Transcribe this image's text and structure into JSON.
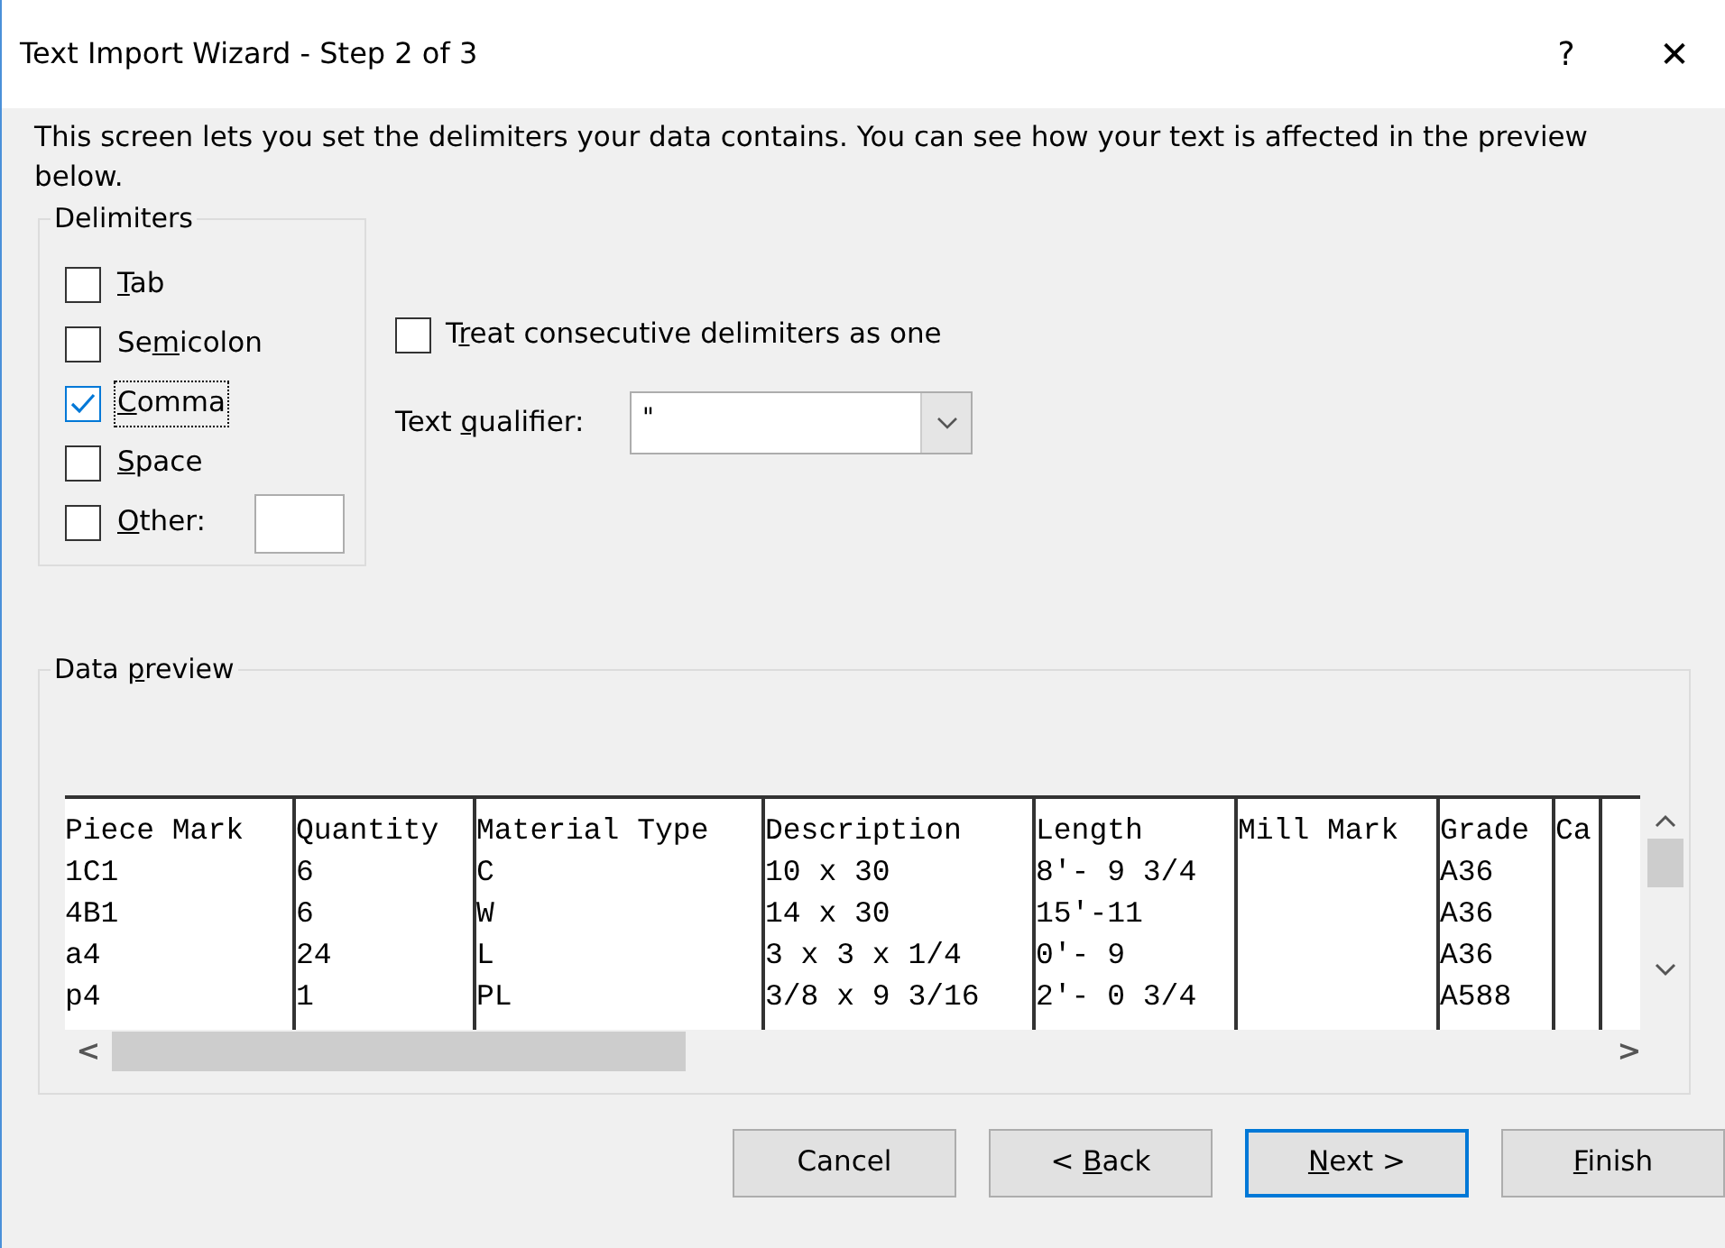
{
  "window": {
    "title": "Text Import Wizard - Step 2 of 3",
    "help": "?",
    "close": "✕"
  },
  "description": "This screen lets you set the delimiters your data contains.  You can see how your text is affected in the preview below.",
  "delimiters": {
    "title": "Delimiters",
    "items": [
      {
        "key": "T",
        "post": "ab",
        "checked": false,
        "focused": false,
        "kind": "plain"
      },
      {
        "pre": "Se",
        "key": "m",
        "post": "icolon",
        "checked": false,
        "focused": false,
        "kind": "plain"
      },
      {
        "key": "C",
        "post": "omma",
        "checked": true,
        "focused": true,
        "kind": "plain"
      },
      {
        "key": "S",
        "post": "pace",
        "checked": false,
        "focused": false,
        "kind": "plain"
      },
      {
        "key": "O",
        "post": "ther:",
        "checked": false,
        "focused": false,
        "kind": "other"
      }
    ]
  },
  "treat_consecutive": {
    "pre": "T",
    "key": "r",
    "post": "eat consecutive delimiters as one",
    "checked": false
  },
  "text_qualifier": {
    "pre": "Text ",
    "key": "q",
    "post": "ualifier:",
    "value": "\""
  },
  "data_preview": {
    "pre": "Data ",
    "key": "p",
    "post": "review",
    "columns": [
      "Piece Mark",
      "Quantity",
      "Material Type",
      "Description",
      "Length",
      "Mill Mark",
      "Grade",
      "Ca"
    ],
    "rows": [
      [
        "1C1",
        "6",
        "C",
        "10 x 30",
        "8'- 9 3/4",
        null,
        "A36",
        null
      ],
      [
        "4B1",
        "6",
        "W",
        "14 x 30",
        "15'-11",
        null,
        "A36",
        null
      ],
      [
        "a4",
        "24",
        "L",
        "3 x 3 x 1/4",
        "0'- 9",
        null,
        "A36",
        null
      ],
      [
        "p4",
        "1",
        "PL",
        "3/8 x 9 3/16",
        "2'- 0 3/4",
        null,
        "A588",
        null
      ]
    ],
    "scroll_left": "<",
    "scroll_right": ">"
  },
  "buttons": [
    {
      "pre": "Cancel",
      "default": false
    },
    {
      "pre": "< ",
      "key": "B",
      "post": "ack",
      "default": false
    },
    {
      "key": "N",
      "post": "ext >",
      "default": true
    },
    {
      "key": "F",
      "post": "inish",
      "default": false
    }
  ]
}
